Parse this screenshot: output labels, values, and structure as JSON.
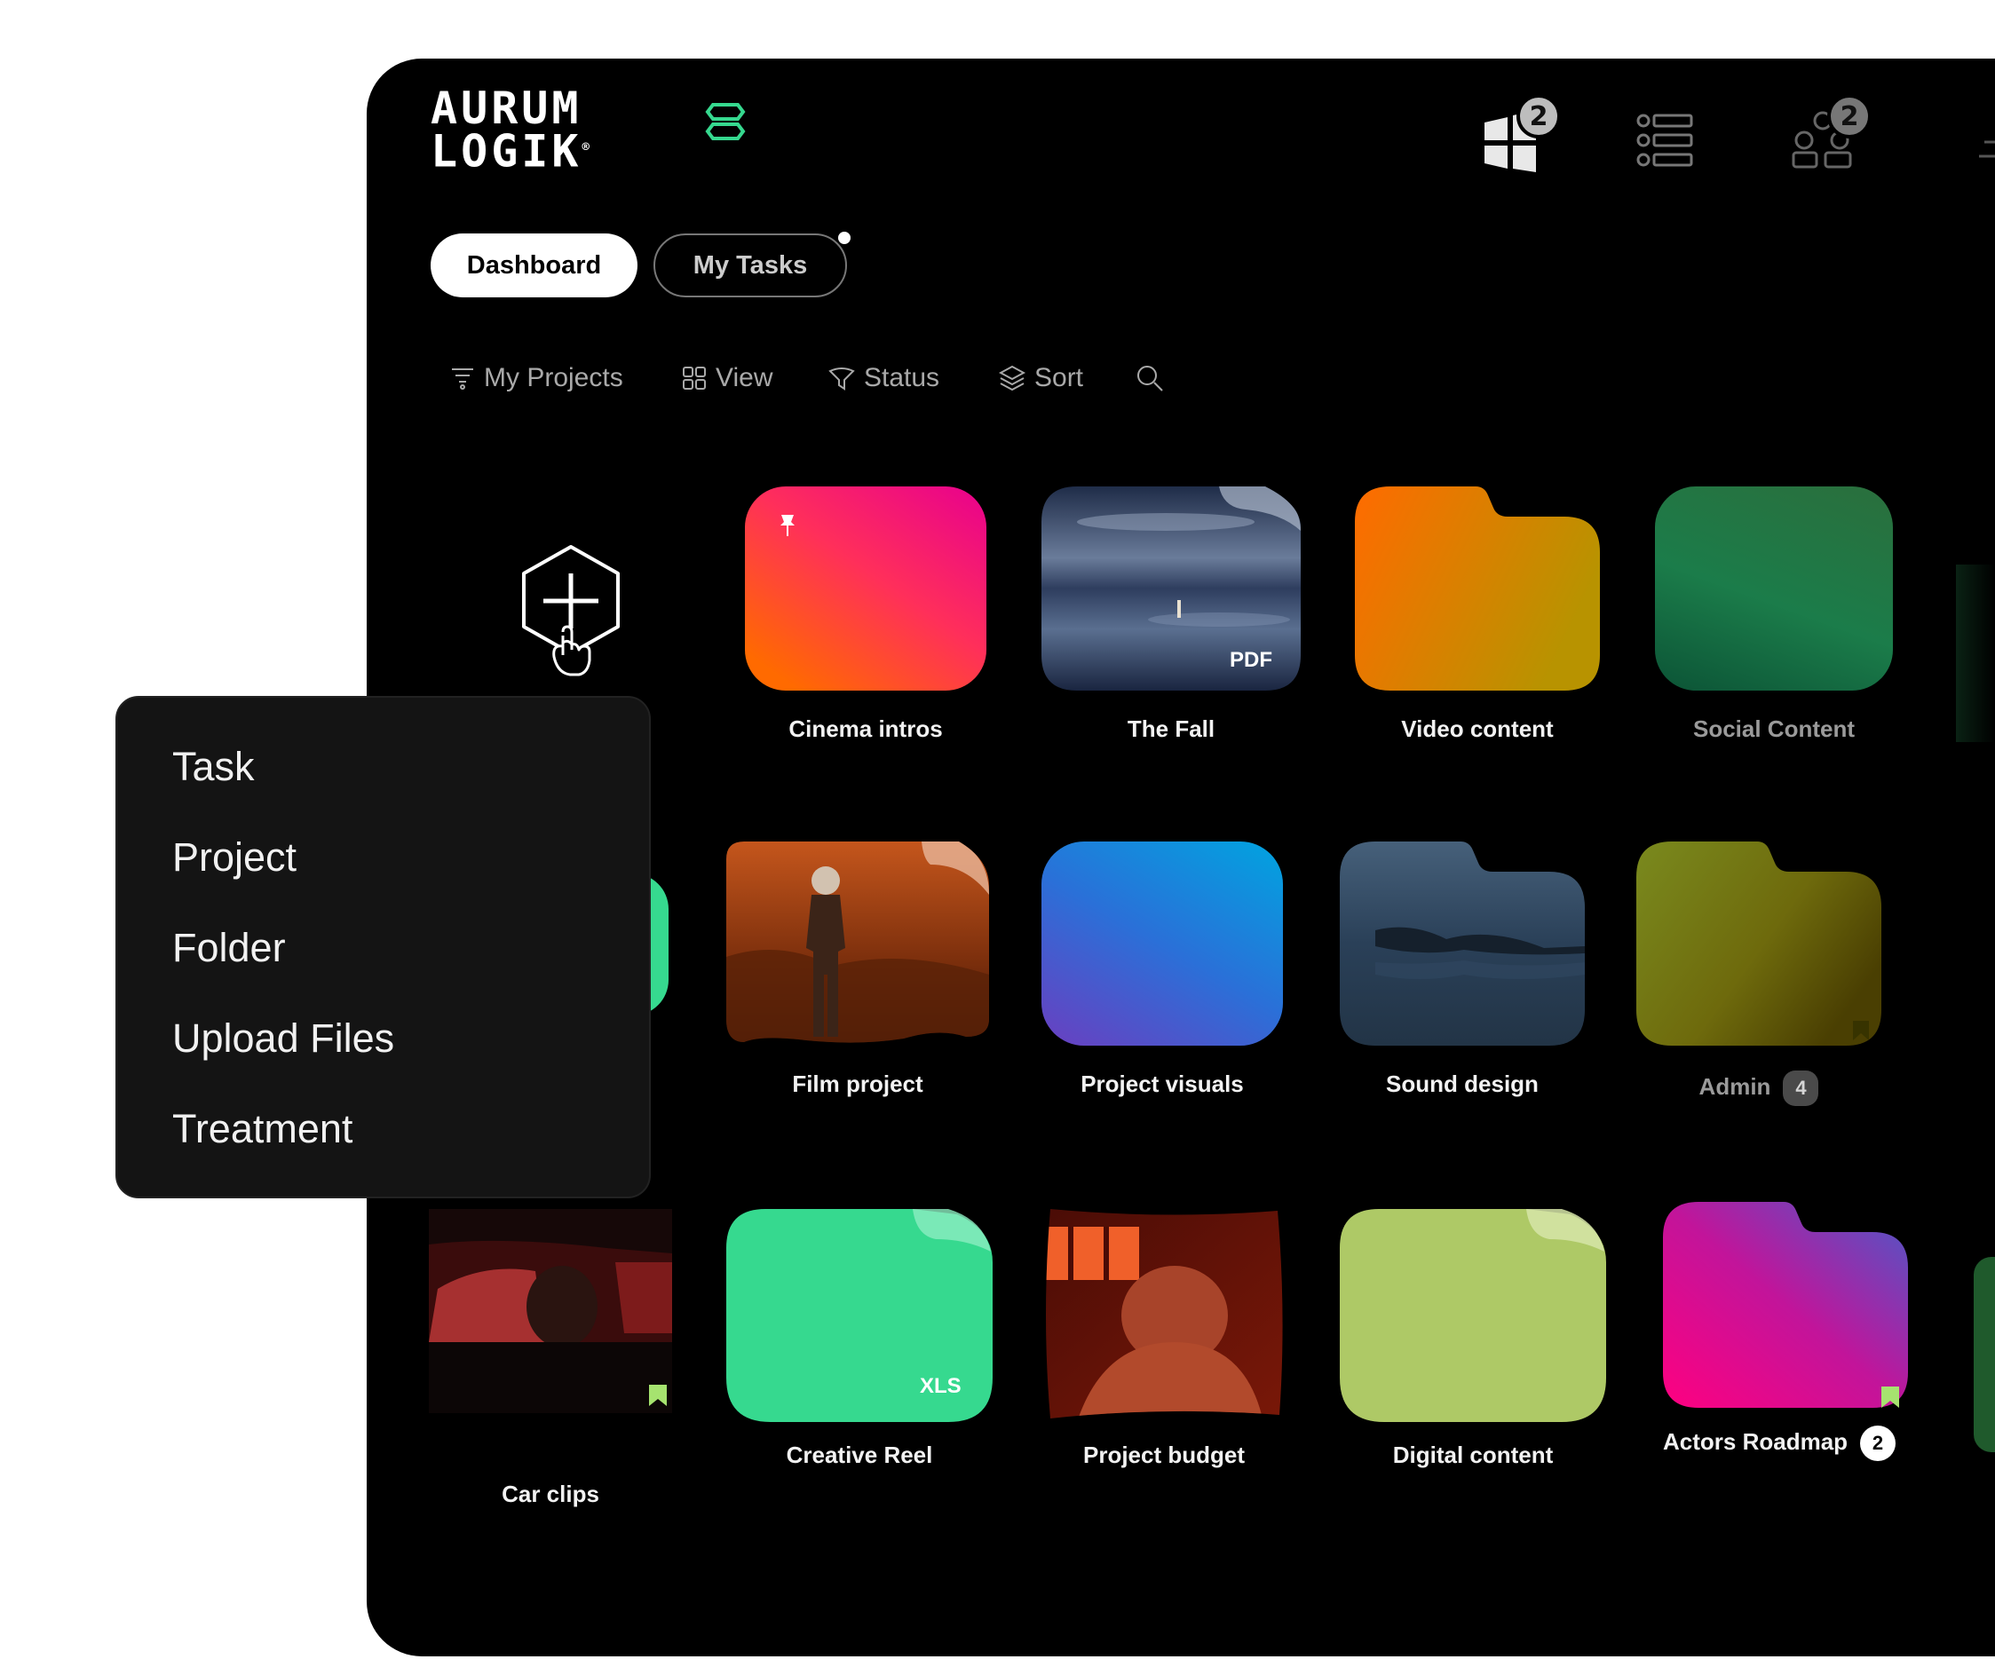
{
  "brand": {
    "logo_line1": "AURUM",
    "logo_line2": "LOGIK",
    "registered": "®"
  },
  "topbar": {
    "apps_badge": "2",
    "people_badge": "2"
  },
  "tabs": [
    {
      "label": "Dashboard",
      "active": true
    },
    {
      "label": "My Tasks",
      "active": false,
      "has_notification": true
    }
  ],
  "toolbar": {
    "my_projects": "My Projects",
    "view": "View",
    "status": "Status",
    "sort": "Sort"
  },
  "menu": {
    "items": [
      "Task",
      "Project",
      "Folder",
      "Upload Files",
      "Treatment"
    ]
  },
  "cards": {
    "row1": [
      {
        "label": "Cinema intros",
        "pinned": true
      },
      {
        "label": "The Fall",
        "file_type": "PDF"
      },
      {
        "label": "Video content"
      },
      {
        "label": "Social Content"
      }
    ],
    "row2": [
      {
        "label": "Film project"
      },
      {
        "label": "Project visuals"
      },
      {
        "label": "Sound design"
      },
      {
        "label": "Admin",
        "count": "4"
      }
    ],
    "row3": [
      {
        "label": "Car clips",
        "bookmarked": true
      },
      {
        "label": "Creative Reel",
        "file_type": "XLS"
      },
      {
        "label": "Project budget"
      },
      {
        "label": "Digital content"
      },
      {
        "label": "Actors Roadmap",
        "count": "2",
        "bookmarked": true
      }
    ]
  },
  "colors": {
    "background": "#000000",
    "accent_green": "#36d98f",
    "bookmark_green": "#a6e36f"
  }
}
